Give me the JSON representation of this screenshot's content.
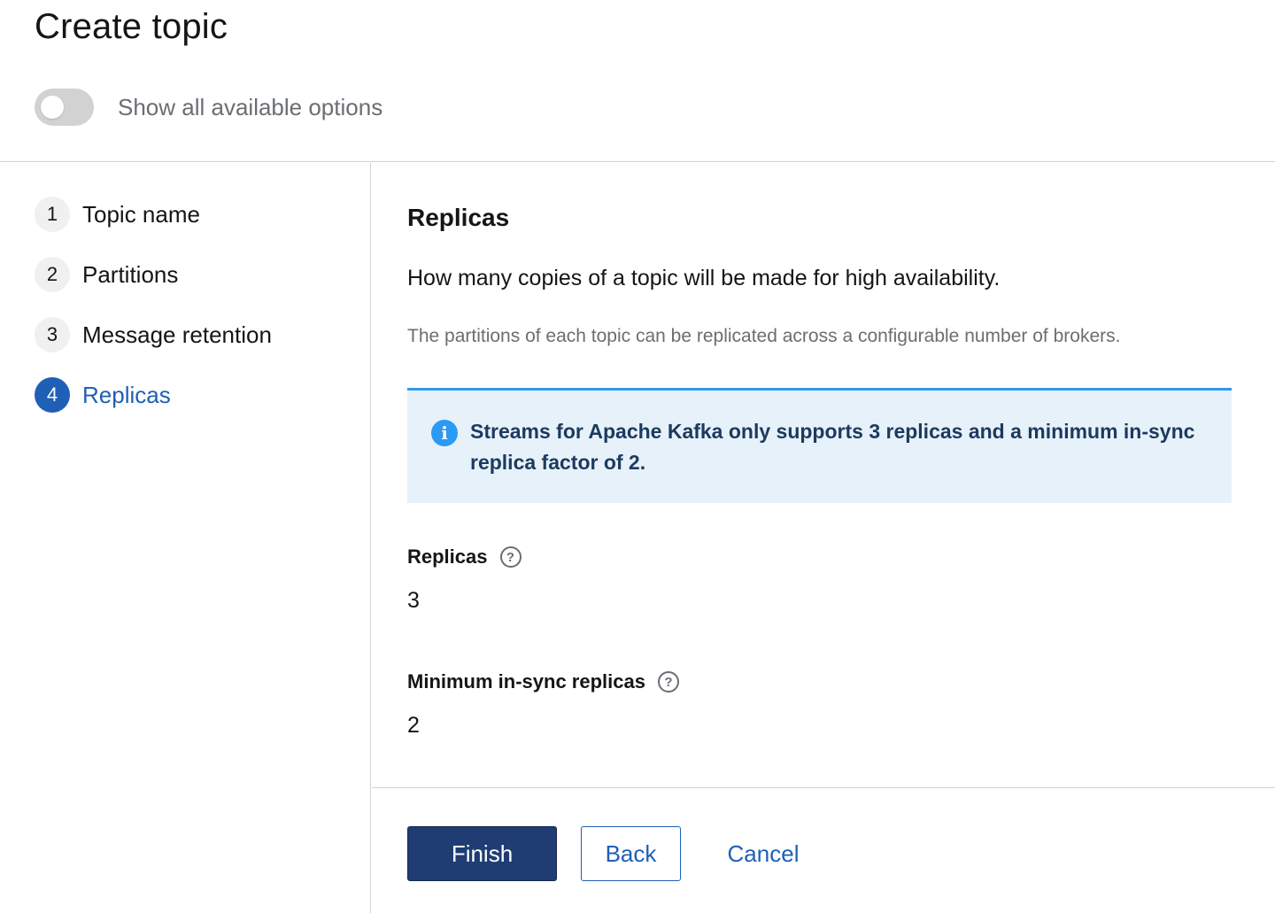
{
  "header": {
    "title": "Create topic",
    "toggle_label": "Show all available options"
  },
  "nav": {
    "steps": [
      {
        "num": "1",
        "label": "Topic name"
      },
      {
        "num": "2",
        "label": "Partitions"
      },
      {
        "num": "3",
        "label": "Message retention"
      },
      {
        "num": "4",
        "label": "Replicas"
      }
    ]
  },
  "main": {
    "title": "Replicas",
    "lead": "How many copies of a topic will be made for high availability.",
    "helper": "The partitions of each topic can be replicated across a configurable number of brokers.",
    "alert": {
      "icon": "info-icon",
      "text": "Streams for Apache Kafka only supports 3 replicas and a minimum in-sync replica factor of 2."
    },
    "fields": [
      {
        "label": "Replicas",
        "value": "3"
      },
      {
        "label": "Minimum in-sync replicas",
        "value": "2"
      }
    ]
  },
  "footer": {
    "finish_label": "Finish",
    "back_label": "Back",
    "cancel_label": "Cancel"
  }
}
